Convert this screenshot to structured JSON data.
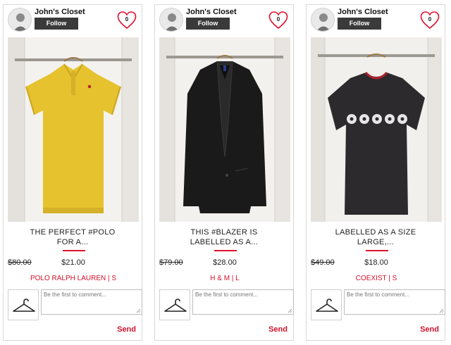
{
  "theme": {
    "accent": "#d0122d",
    "follow_bg": "#3a3a3a",
    "divider": "#e0102c"
  },
  "cards": [
    {
      "owner": "John's Closet",
      "follow_label": "Follow",
      "like_count": "0",
      "image_subject": "yellow polo shirt on hanger",
      "title": "THE PERFECT #POLO\nFOR A...",
      "original_price": "$80.00",
      "price": "$21.00",
      "brand_size": "POLO RALPH LAUREN | S",
      "comment_placeholder": "Be the first to comment...",
      "send_label": "Send",
      "icons": [
        "heart-icon",
        "hanger-icon"
      ]
    },
    {
      "owner": "John's Closet",
      "follow_label": "Follow",
      "like_count": "0",
      "image_subject": "black blazer on hanger",
      "title": "THIS #BLAZER IS\nLABELLED AS A...",
      "original_price": "$79.00",
      "price": "$28.00",
      "brand_size": "H & M | L",
      "comment_placeholder": "Be the first to comment...",
      "send_label": "Send",
      "icons": [
        "heart-icon",
        "hanger-icon"
      ]
    },
    {
      "owner": "John's Closet",
      "follow_label": "Follow",
      "like_count": "0",
      "image_subject": "dark snowflake t-shirt on hanger",
      "title": "LABELLED AS A SIZE\nLARGE,...",
      "original_price": "$49.00",
      "price": "$18.00",
      "brand_size": "COEXIST | S",
      "comment_placeholder": "Be the first to comment...",
      "send_label": "Send",
      "icons": [
        "heart-icon",
        "hanger-icon"
      ]
    }
  ]
}
